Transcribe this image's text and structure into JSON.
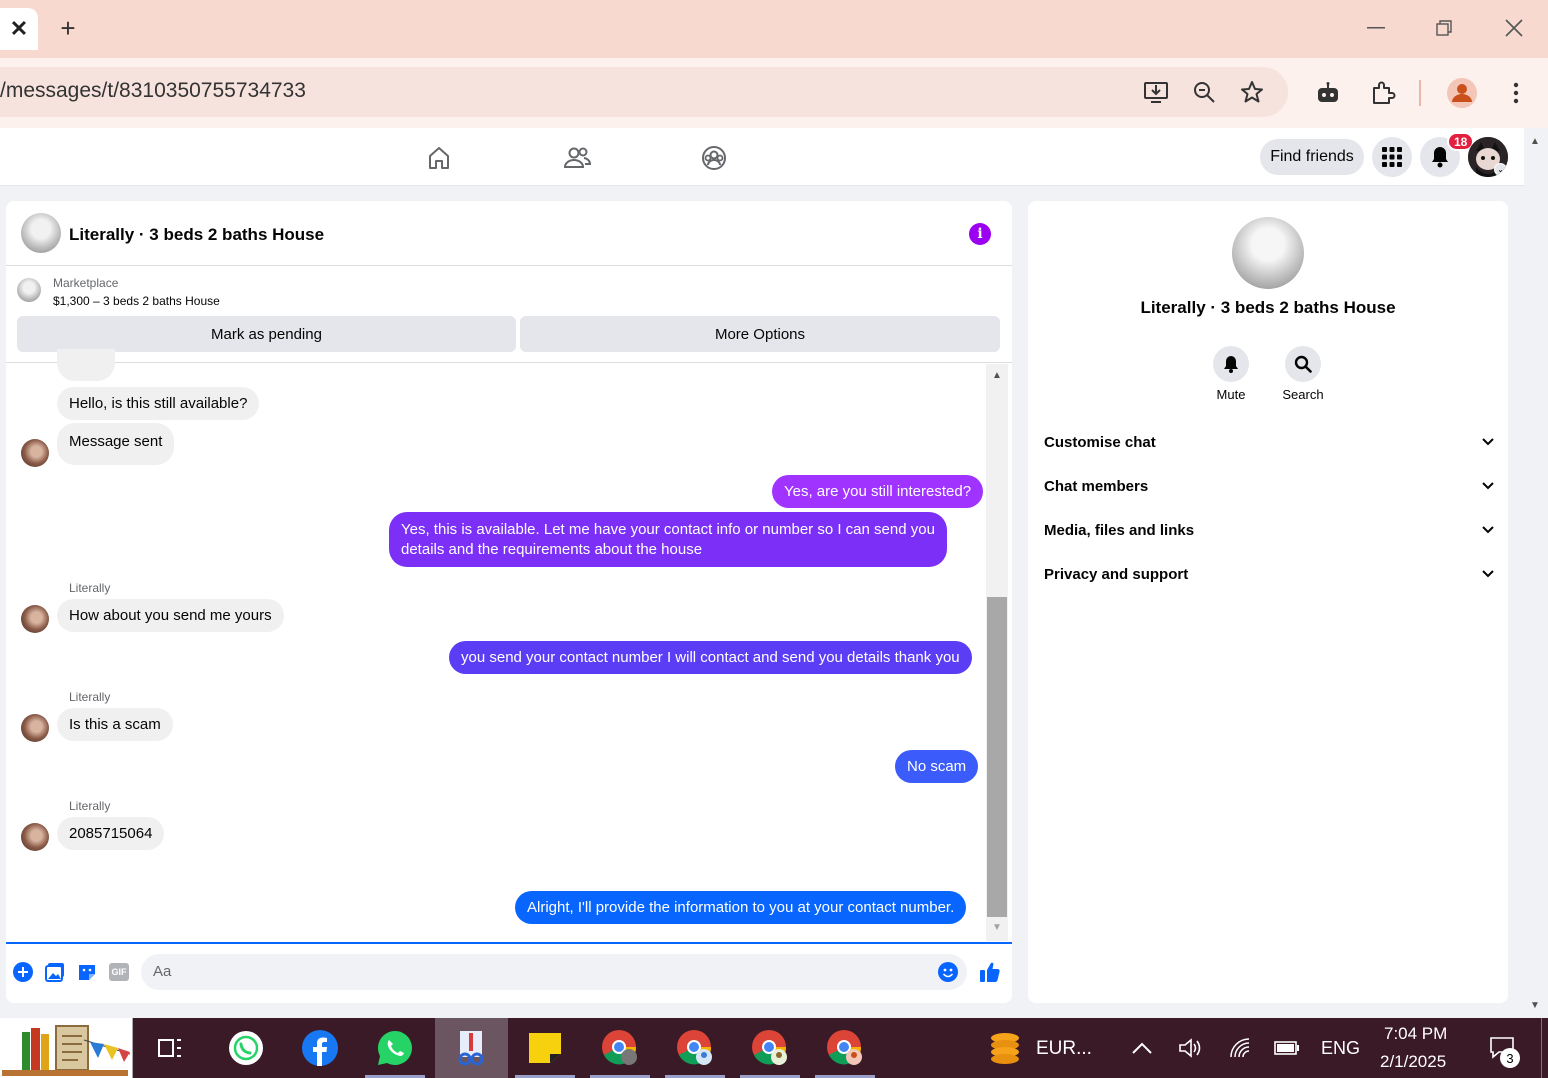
{
  "browser": {
    "url": "/messages/t/8310350755734733",
    "new_tab_label": "+",
    "tab_close_label": "✕"
  },
  "header": {
    "find_friends": "Find friends",
    "notification_count": "18"
  },
  "chat": {
    "title": "Literally · 3 beds 2 baths House",
    "marketplace_label": "Marketplace",
    "listing": "$1,300 – 3 beds 2 baths House",
    "mark_pending": "Mark as pending",
    "more_options": "More Options",
    "messages": [
      {
        "from": "them",
        "text": "Hello, is this still available?"
      },
      {
        "from": "them",
        "text": "Message sent"
      },
      {
        "from": "me",
        "text": "Yes, are you still interested?"
      },
      {
        "from": "me",
        "text_line1": "Yes, this is available. Let me have your contact info or number so I can send you",
        "text_line2": "details and the requirements about the house"
      },
      {
        "from": "them",
        "sender": "Literally",
        "text": "How about you send me yours"
      },
      {
        "from": "me",
        "text": "you send your contact number I will contact  and send you details thank you"
      },
      {
        "from": "them",
        "sender": "Literally",
        "text": "Is this a scam"
      },
      {
        "from": "me",
        "text": "No scam"
      },
      {
        "from": "them",
        "sender": "Literally",
        "text": "2085715064"
      },
      {
        "from": "me",
        "text": "Alright, I'll provide the information to you at your contact number."
      }
    ],
    "input_placeholder": "Aa",
    "gif_label": "GIF"
  },
  "side": {
    "title": "Literally · 3 beds 2 baths House",
    "mute_label": "Mute",
    "search_label": "Search",
    "sections": [
      "Customise chat",
      "Chat members",
      "Media, files and links",
      "Privacy and support"
    ]
  },
  "taskbar": {
    "currency": "EUR...",
    "language": "ENG",
    "time": "7:04 PM",
    "date": "2/1/2025",
    "notif_count": "3"
  },
  "colors": {
    "purple_bubble": "#a033ff",
    "violet_bubble": "#7b2ff7",
    "indigo_bubble": "#5b3df5",
    "blue_bubble": "#3b5bfa",
    "messenger_blue": "#0866ff"
  }
}
